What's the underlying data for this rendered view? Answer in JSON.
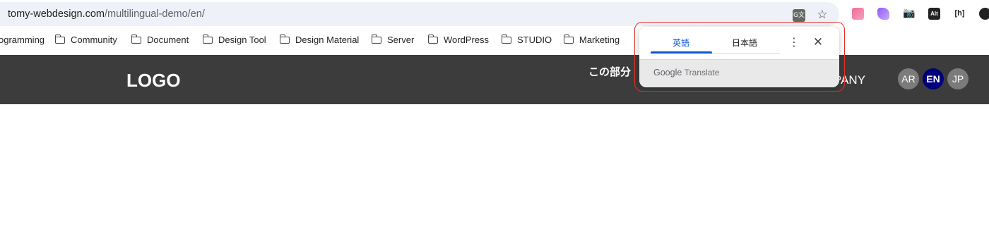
{
  "browser": {
    "url_host": "tomy-webdesign.com",
    "url_path": "/multilingual-demo/en/",
    "translate_icon_glyph": "G文",
    "bookmark_star_glyph": "☆",
    "extensions": [
      {
        "icon": "pink-square-extension-icon",
        "glyph": ""
      },
      {
        "icon": "purple-leaf-extension-icon",
        "glyph": ""
      },
      {
        "icon": "camera-extension-icon",
        "glyph": "📷"
      },
      {
        "icon": "alt-text-extension-icon",
        "glyph": "Alt"
      },
      {
        "icon": "html-bracket-extension-icon",
        "glyph": "[h]"
      },
      {
        "icon": "globe-extension-icon",
        "glyph": ""
      }
    ]
  },
  "bookmarks": [
    {
      "label": "ogramming"
    },
    {
      "label": "Community"
    },
    {
      "label": "Document"
    },
    {
      "label": "Design Tool"
    },
    {
      "label": "Design Material"
    },
    {
      "label": "Server"
    },
    {
      "label": "WordPress"
    },
    {
      "label": "STUDIO"
    },
    {
      "label": "Marketing"
    }
  ],
  "site": {
    "logo": "LOGO",
    "annotation": "この部分",
    "nav_peek": "PANY",
    "languages": [
      "AR",
      "EN",
      "JP"
    ],
    "active_language": "EN",
    "header_color": "#3c3c3c",
    "active_language_color": "#00007a"
  },
  "translate_popup": {
    "tabs": [
      "英語",
      "日本語"
    ],
    "active_tab": "英語",
    "more_glyph": "⋮",
    "close_glyph": "✕",
    "footer_brand": "Google",
    "footer_product": "Translate",
    "accent": "#0b57d0",
    "highlight_color": "#e0322a"
  }
}
